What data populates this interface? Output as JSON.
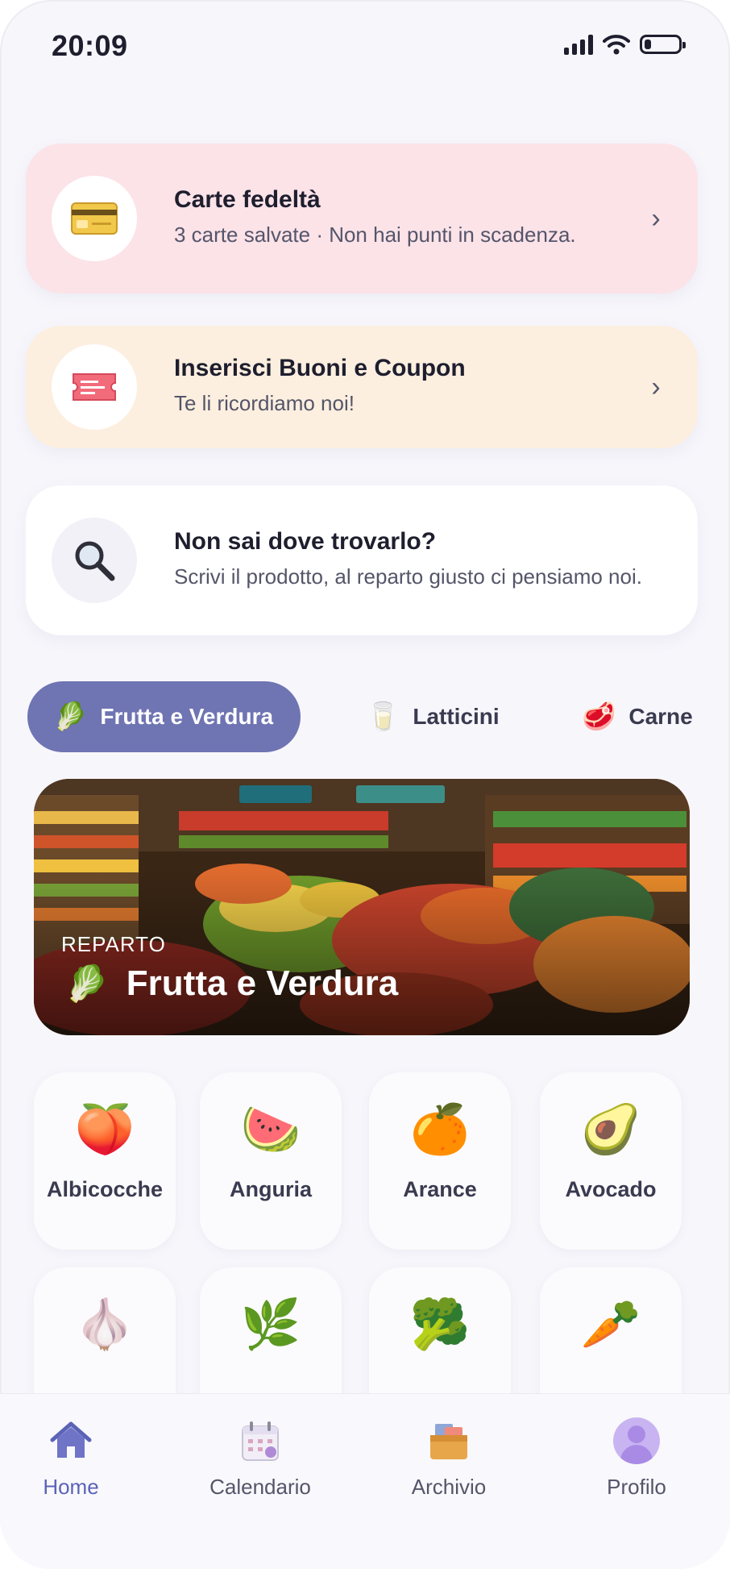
{
  "status_bar": {
    "time": "20:09",
    "battery_level": 0.2
  },
  "cards": [
    {
      "title": "Carte fedeltà",
      "subtitle": "3 carte salvate · Non hai punti in scadenza.",
      "icon": "credit-card-icon",
      "background": "#fbe3e8"
    },
    {
      "title": "Inserisci Buoni e Coupon",
      "subtitle": "Te li ricordiamo noi!",
      "icon": "ticket-icon",
      "background": "#fcefdf"
    },
    {
      "title": "Non sai dove trovarlo?",
      "subtitle": "Scrivi il prodotto, al reparto giusto ci pensiamo noi.",
      "icon": "magnifier-icon",
      "background": "#ffffff"
    }
  ],
  "chips": [
    {
      "label": "Frutta e Verdura",
      "icon": "🥬",
      "active": true
    },
    {
      "label": "Latticini",
      "icon": "🥛",
      "active": false
    },
    {
      "label": "Carne",
      "icon": "🥩",
      "active": false
    }
  ],
  "banner": {
    "kicker": "REPARTO",
    "title": "Frutta e Verdura",
    "icon": "🥬"
  },
  "products": [
    {
      "label": "Albicocche",
      "icon": "🍑"
    },
    {
      "label": "Anguria",
      "icon": "🍉"
    },
    {
      "label": "Arance",
      "icon": "🍊"
    },
    {
      "label": "Avocado",
      "icon": "🥑"
    },
    {
      "label": "",
      "icon": "🧄"
    },
    {
      "label": "",
      "icon": "🌿"
    },
    {
      "label": "",
      "icon": "🥦"
    },
    {
      "label": "",
      "icon": "🥕"
    }
  ],
  "nav": [
    {
      "label": "Home",
      "icon": "home-icon",
      "active": true
    },
    {
      "label": "Calendario",
      "icon": "calendar-icon",
      "active": false
    },
    {
      "label": "Archivio",
      "icon": "archive-box-icon",
      "active": false
    },
    {
      "label": "Profilo",
      "icon": "avatar-icon",
      "active": false
    }
  ],
  "colors": {
    "accent": "#5b63b7",
    "chip_active": "#6f74b3"
  }
}
